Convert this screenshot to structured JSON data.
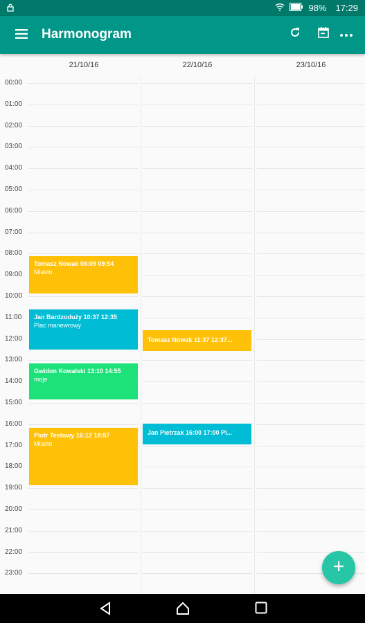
{
  "status": {
    "battery": "98%",
    "time": "17:29"
  },
  "appbar": {
    "title": "Harmonogram"
  },
  "days": [
    "21/10/16",
    "22/10/16",
    "23/10/16"
  ],
  "hours": [
    "00:00",
    "01:00",
    "02:00",
    "03:00",
    "04:00",
    "05:00",
    "06:00",
    "07:00",
    "08:00",
    "09:00",
    "10:00",
    "11:00",
    "12:00",
    "13:00",
    "14:00",
    "15:00",
    "16:00",
    "17:00",
    "18:00",
    "19:00",
    "20:00",
    "21:00",
    "22:00",
    "23:00"
  ],
  "events": [
    {
      "title": "Tomasz Nowak 08:09 09:54",
      "place": "Miasto"
    },
    {
      "title": "Jan Bardzoduży 10:37 12:35",
      "place": "Plac manewrowy"
    },
    {
      "title": "Gwidon Kowalski 13:10 14:55",
      "place": "moje"
    },
    {
      "title": "Piotr Testowy 16:12 18:57",
      "place": "Miasto"
    },
    {
      "title": "Tomasz Nowak 11:37 12:37...",
      "place": ""
    },
    {
      "title": "Jan Pietrzak 16:00 17:00 Pl...",
      "place": ""
    }
  ],
  "colors": {
    "primary": "#009688",
    "primary_dark": "#00796b",
    "amber": "#ffc107",
    "cyan": "#00bcd4",
    "green": "#1de27a",
    "fab": "#26c6a6"
  },
  "icons": [
    "lock-icon",
    "wifi-icon",
    "battery-icon",
    "menu-icon",
    "refresh-icon",
    "calendar-icon",
    "more-icon",
    "add-icon",
    "back-icon",
    "home-icon",
    "recents-icon"
  ]
}
